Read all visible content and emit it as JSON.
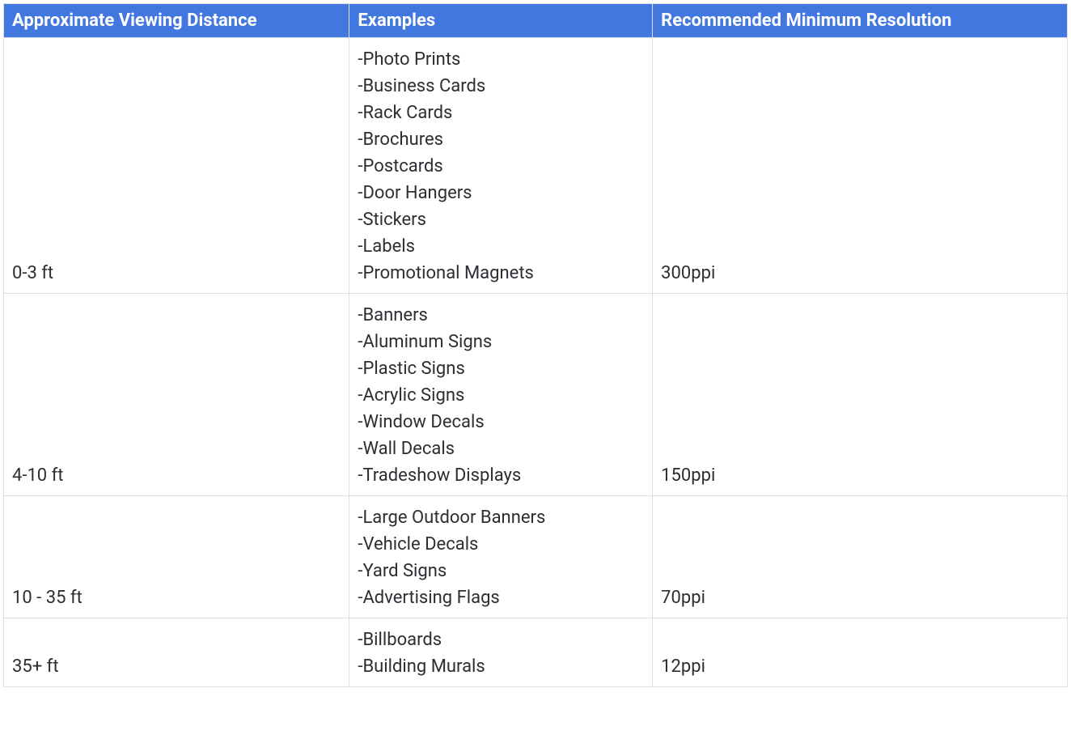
{
  "table": {
    "headers": {
      "col1": "Approximate Viewing Distance",
      "col2": "Examples",
      "col3": "Recommended Minimum Resolution"
    },
    "rows": [
      {
        "distance": "0-3 ft",
        "examples": "-Photo Prints\n-Business Cards\n-Rack Cards\n-Brochures\n-Postcards\n-Door Hangers\n-Stickers\n-Labels\n-Promotional Magnets",
        "resolution": "300ppi"
      },
      {
        "distance": "4-10 ft",
        "examples": "-Banners\n-Aluminum Signs\n-Plastic Signs\n-Acrylic Signs\n-Window Decals\n-Wall Decals\n-Tradeshow Displays",
        "resolution": "150ppi"
      },
      {
        "distance": "10 - 35 ft",
        "examples": "-Large Outdoor Banners\n-Vehicle Decals\n-Yard Signs\n-Advertising Flags",
        "resolution": "70ppi"
      },
      {
        "distance": "35+ ft",
        "examples": "-Billboards\n-Building Murals",
        "resolution": "12ppi"
      }
    ]
  }
}
